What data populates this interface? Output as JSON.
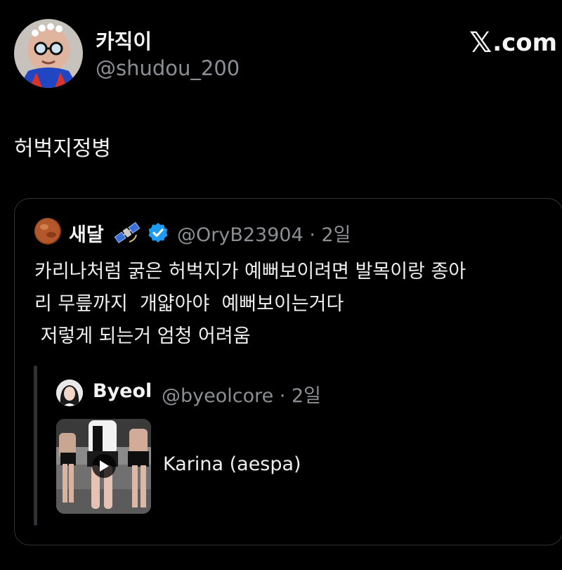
{
  "author": {
    "display_name": "카직이",
    "handle": "@shudou_200"
  },
  "brand": {
    "x_glyph": "𝕏",
    "suffix": ".com"
  },
  "tweet": {
    "text": "허벅지정병"
  },
  "quoted_tweet": {
    "display_name": "새달",
    "emoji": "🛰",
    "handle_time": "@OryB23904 · 2일",
    "lines": [
      "카리나처럼 굵은 허벅지가 예뻐보이려면 발목이랑 종아",
      "리 무릎까지  개얇아야  예뻐보이는거다",
      " 저렇게 되는거 엄청 어려움"
    ],
    "verified_color": "#1d9bf0"
  },
  "nested_quote": {
    "display_name": "Byeol",
    "handle_time": "@byeolcore · 2일",
    "media_title": "Karina (aespa)",
    "media_icon": "play-icon"
  },
  "colors": {
    "background": "#000000",
    "text": "#e7e9ea",
    "muted": "#8b8f94",
    "border": "#2f3336"
  }
}
